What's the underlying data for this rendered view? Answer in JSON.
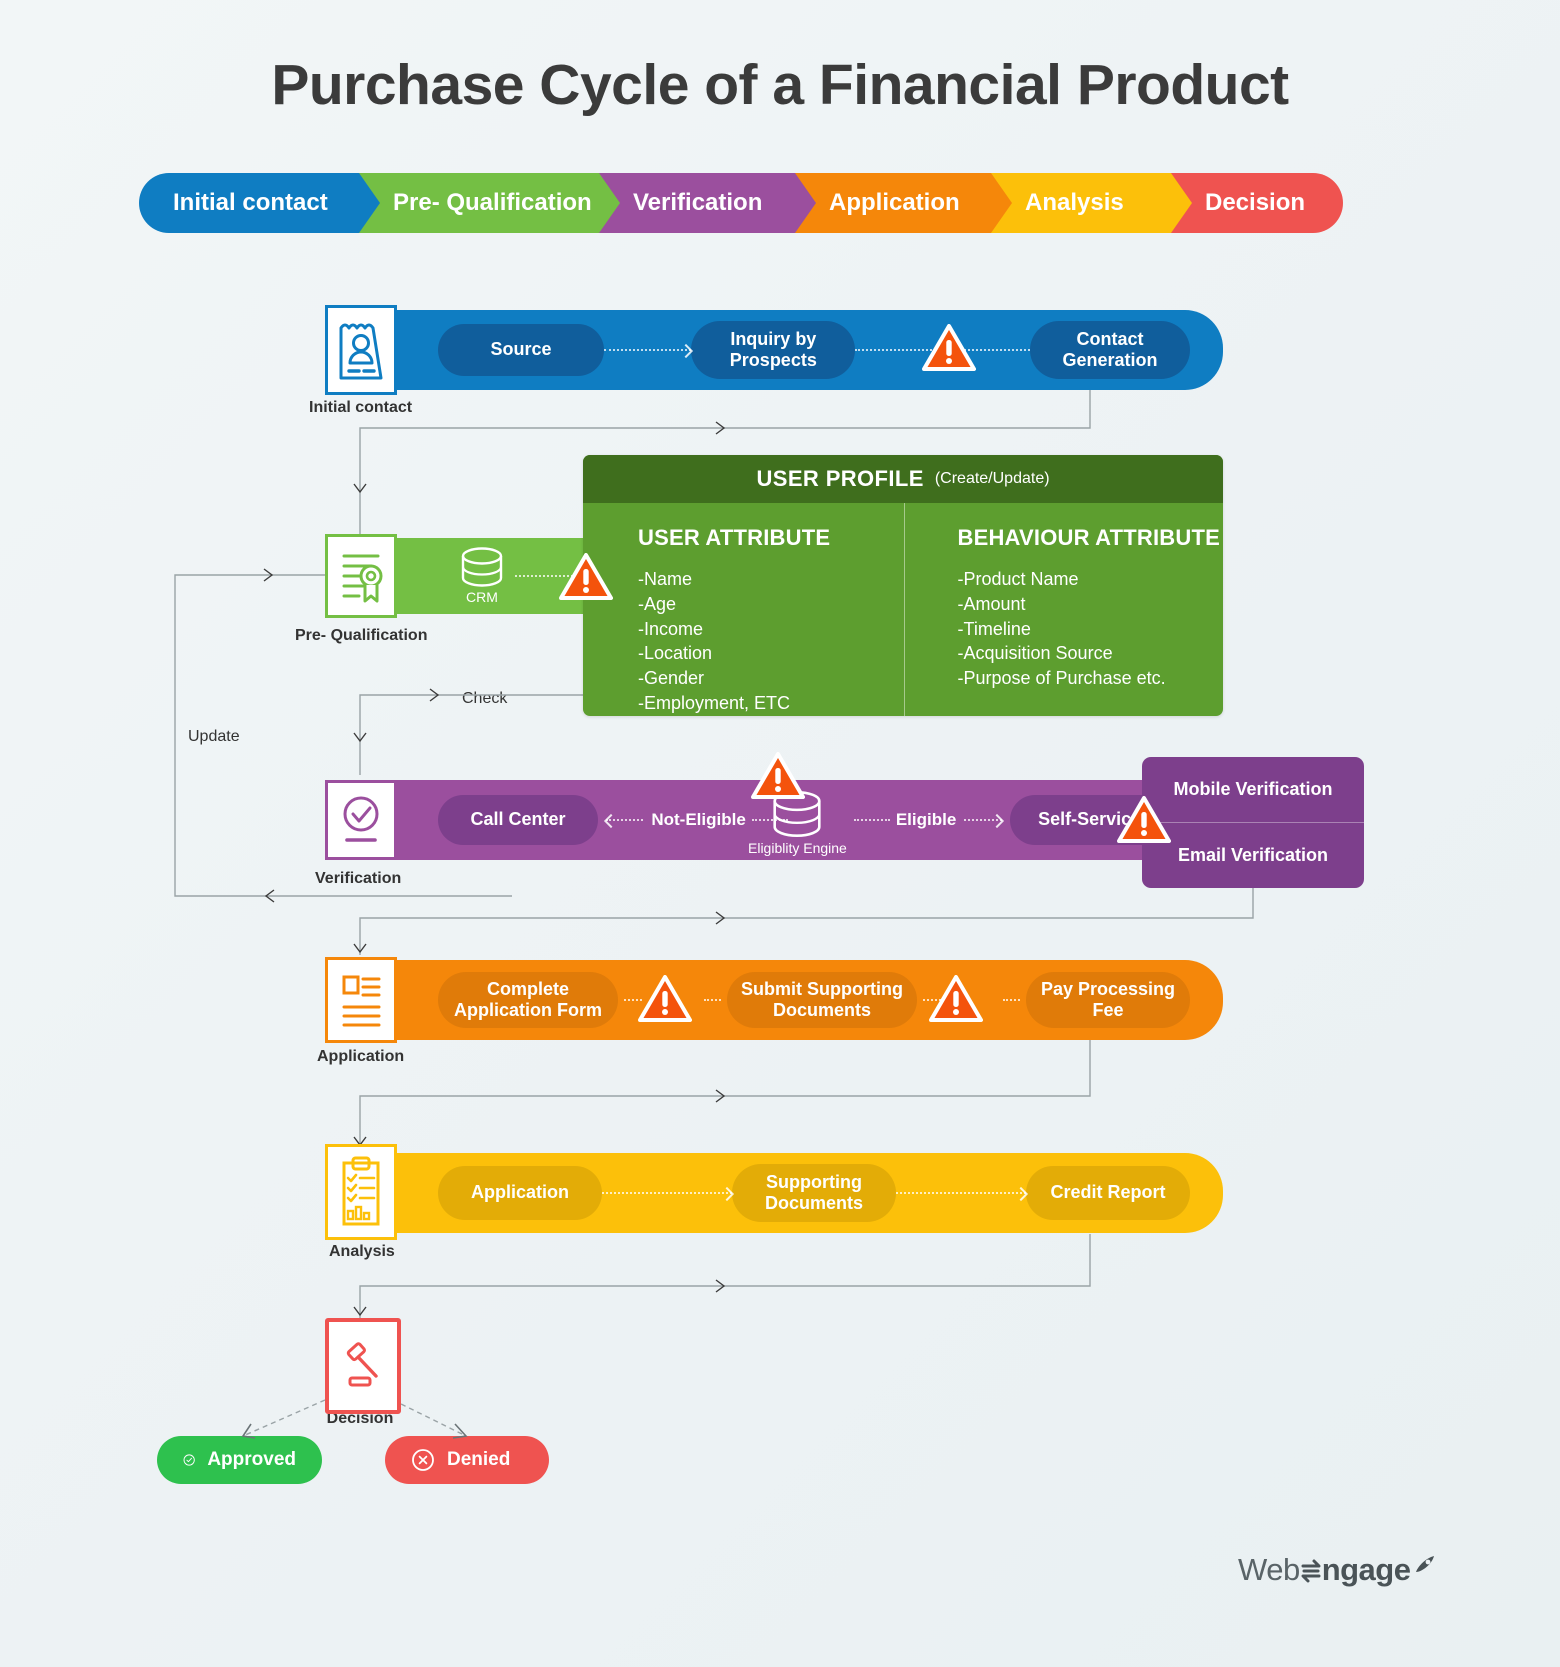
{
  "title": "Purchase Cycle of a Financial Product",
  "stages": [
    {
      "label": "Initial contact",
      "color": "#0f7dc2"
    },
    {
      "label": "Pre- Qualification",
      "color": "#74bf44"
    },
    {
      "label": "Verification",
      "color": "#9b4f9e"
    },
    {
      "label": "Application",
      "color": "#f5870a"
    },
    {
      "label": "Analysis",
      "color": "#fcc00a"
    },
    {
      "label": "Decision",
      "color": "#ef5350"
    }
  ],
  "lanes": {
    "initial_contact": {
      "label": "Initial contact",
      "color": "#0f7dc2",
      "pill_color": "#105e9c",
      "icon": "id-card-user-icon",
      "steps": [
        "Source",
        "Inquiry by Prospects",
        "Contact Generation"
      ]
    },
    "pre_qualification": {
      "label": "Pre- Qualification",
      "color": "#74bf44",
      "icon": "certificate-seal-icon",
      "db_label": "CRM"
    },
    "verification": {
      "label": "Verification",
      "color": "#9b4f9e",
      "pill_color": "#7d3f8c",
      "icon": "check-circle-doc-icon",
      "steps": [
        "Call Center",
        "Self-Service"
      ],
      "edge_left": "Not-Eligible",
      "edge_right": "Eligible",
      "db_label": "Eligiblity Engine",
      "side_box": [
        "Mobile Verification",
        "Email Verification"
      ]
    },
    "application": {
      "label": "Application",
      "color": "#f5870a",
      "pill_color": "#e07b09",
      "icon": "form-document-icon",
      "steps": [
        "Complete Application Form",
        "Submit Supporting Documents",
        "Pay Processing Fee"
      ]
    },
    "analysis": {
      "label": "Analysis",
      "color": "#fcc00a",
      "pill_color": "#e3ac07",
      "icon": "clipboard-checklist-icon",
      "steps": [
        "Application",
        "Supporting Documents",
        "Credit Report"
      ]
    },
    "decision": {
      "label": "Decision",
      "color": "#ef5350",
      "icon": "gavel-icon",
      "outcomes": [
        {
          "label": "Approved",
          "color": "#2ec14e",
          "icon": "check-circle-icon"
        },
        {
          "label": "Denied",
          "color": "#ef5350",
          "icon": "x-circle-icon"
        }
      ]
    }
  },
  "user_profile": {
    "title": "USER PROFILE",
    "subtitle": "(Create/Update)",
    "left_heading": "USER ATTRIBUTE",
    "left_items": [
      "-Name",
      "-Age",
      "-Income",
      "-Location",
      "-Gender",
      "-Employment, ETC"
    ],
    "right_heading": "BEHAVIOUR ATTRIBUTE",
    "right_items": [
      "-Product Name",
      "-Amount",
      "-Timeline",
      "-Acquisition Source",
      "-Purpose of Purchase etc."
    ]
  },
  "flow_labels": {
    "update": "Update",
    "check": "Check"
  },
  "logo": {
    "part1": "Web",
    "part2": "ngage"
  }
}
